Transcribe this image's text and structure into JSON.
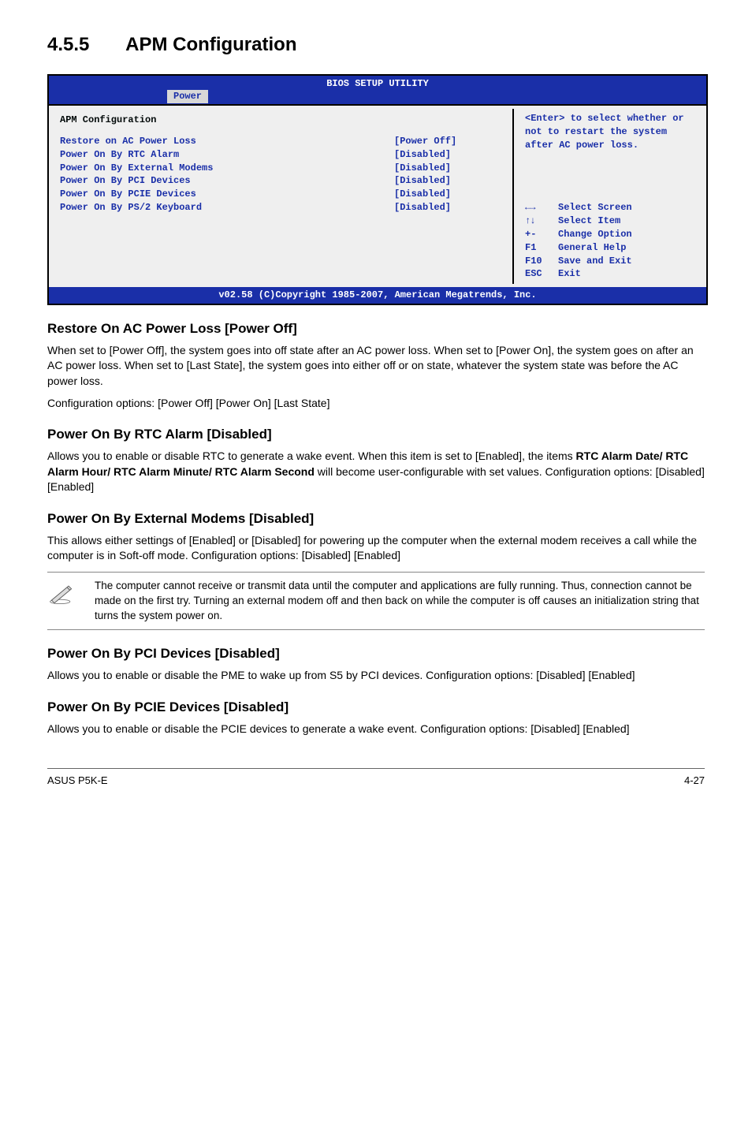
{
  "section": {
    "number": "4.5.5",
    "title": "APM Configuration"
  },
  "bios": {
    "title": "BIOS SETUP UTILITY",
    "tab": "Power",
    "panel_heading": "APM Configuration",
    "items": [
      {
        "label": "Restore on AC Power Loss",
        "value": "[Power Off]"
      },
      {
        "label": "Power On By RTC Alarm",
        "value": "[Disabled]"
      },
      {
        "label": "Power On By External Modems",
        "value": "[Disabled]"
      },
      {
        "label": "Power On By PCI Devices",
        "value": "[Disabled]"
      },
      {
        "label": "Power On By PCIE Devices",
        "value": "[Disabled]"
      },
      {
        "label": "Power On By PS/2 Keyboard",
        "value": "[Disabled]"
      }
    ],
    "help_top": "<Enter> to select whether or not to restart the system after AC power loss.",
    "keys": [
      {
        "k": "←→",
        "d": "Select Screen"
      },
      {
        "k": "↑↓",
        "d": "Select Item"
      },
      {
        "k": "+-",
        "d": "Change Option"
      },
      {
        "k": "F1",
        "d": "General Help"
      },
      {
        "k": "F10",
        "d": "Save and Exit"
      },
      {
        "k": "ESC",
        "d": "Exit"
      }
    ],
    "footer": "v02.58 (C)Copyright 1985-2007, American Megatrends, Inc."
  },
  "subsections": {
    "restore": {
      "heading": "Restore On AC Power Loss [Power Off]",
      "body": "When set to [Power Off], the system goes into off state after an AC power loss. When set to [Power On], the system goes on after an AC power loss. When set to [Last State], the system goes into either off or on state, whatever the system state was before the AC power loss.",
      "opts": "Configuration options: [Power Off] [Power On] [Last State]"
    },
    "rtc": {
      "heading": "Power On By RTC Alarm [Disabled]",
      "body_pre": "Allows you to enable or disable RTC to generate a wake event. When this item is set to [Enabled], the items ",
      "body_bold": "RTC Alarm Date/ RTC Alarm Hour/ RTC Alarm Minute/ RTC Alarm Second",
      "body_post": " will become user-configurable with set values. Configuration options: [Disabled] [Enabled]"
    },
    "ext": {
      "heading": "Power On By External Modems [Disabled]",
      "body": "This allows either settings of [Enabled] or [Disabled] for powering up the computer when the external modem receives a call while the computer is in Soft-off mode. Configuration options: [Disabled] [Enabled]"
    },
    "note": "The computer cannot receive or transmit data until the computer and applications are fully running. Thus, connection cannot be made on the first try. Turning an external modem off and then back on while the computer is off causes an initialization string that turns the system power on.",
    "pci": {
      "heading": "Power On By PCI Devices [Disabled]",
      "body": "Allows you to enable or disable the PME to wake up from S5 by PCI devices. Configuration options: [Disabled] [Enabled]"
    },
    "pcie": {
      "heading": "Power On By PCIE Devices [Disabled]",
      "body": "Allows you to enable or disable the PCIE devices to generate a wake event. Configuration options: [Disabled] [Enabled]"
    }
  },
  "footer": {
    "left": "ASUS P5K-E",
    "right": "4-27"
  }
}
